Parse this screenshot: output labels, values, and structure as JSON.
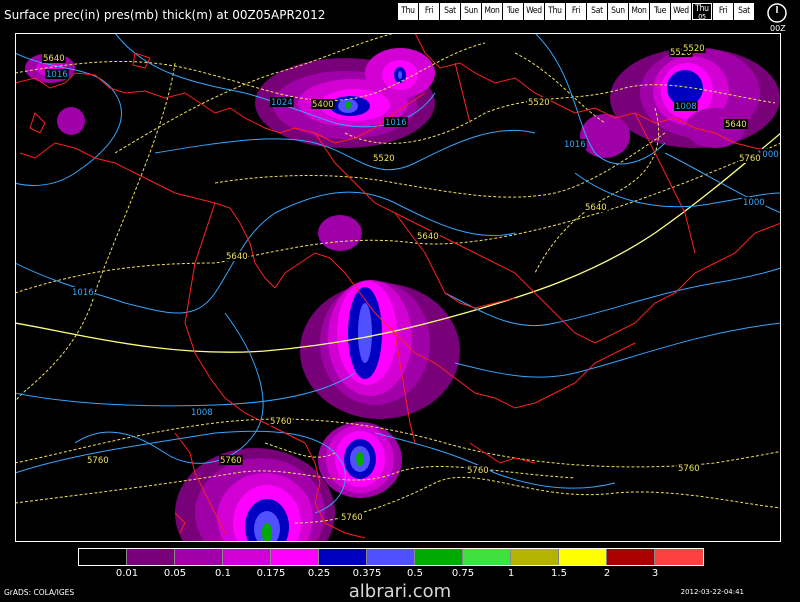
{
  "header": {
    "title": "Surface prec(in) pres(mb) thick(m) at 00Z05APR2012",
    "days": [
      "Thu",
      "Fri",
      "Sat",
      "Sun",
      "Mon",
      "Tue",
      "Wed",
      "Thu",
      "Fri",
      "Sat",
      "Sun",
      "Mon",
      "Tue",
      "Wed",
      "Thu",
      "Fri",
      "Sat"
    ],
    "current_day_index": 14,
    "current_day_number": "05",
    "clock_label": "00Z"
  },
  "map": {
    "pressure_labels": [
      "1016",
      "1024",
      "1016",
      "1016",
      "1016",
      "1008",
      "1008",
      "1000",
      "1000"
    ],
    "thickness_labels": [
      "5640",
      "5400",
      "5520",
      "5520",
      "5520",
      "5640",
      "5640",
      "5640",
      "5640",
      "5760",
      "5760",
      "5760",
      "5760",
      "5760",
      "5760",
      "5760",
      "5520"
    ],
    "colors": {
      "isobar": "#35a6ff",
      "thickness": "#f0e060",
      "thickness_ref": "#ffff80",
      "coastline": "#ff2020"
    }
  },
  "legend": {
    "colors": [
      "#000000",
      "#780078",
      "#a000a8",
      "#d200d2",
      "#ff00ff",
      "#0000c0",
      "#5050ff",
      "#00aa00",
      "#40e040",
      "#b4b400",
      "#ffff00",
      "#aa0000",
      "#ff4040"
    ],
    "labels": [
      "0.01",
      "0.05",
      "0.1",
      "0.175",
      "0.25",
      "0.375",
      "0.5",
      "0.75",
      "1",
      "1.5",
      "2",
      "3"
    ]
  },
  "footer": {
    "credit": "GrADS: COLA/IGES",
    "watermark": "albrari.com",
    "timestamp": "2012-03-22-04:41"
  }
}
